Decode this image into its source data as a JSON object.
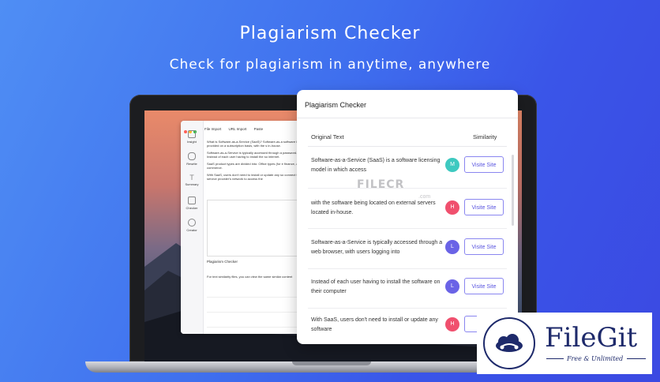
{
  "hero": {
    "title": "Plagiarism Checker",
    "subtitle": "Check for plagiarism in anytime, anywhere"
  },
  "app": {
    "sidebar": [
      {
        "label": "Insight",
        "icon": "insight-icon"
      },
      {
        "label": "Rewrite",
        "icon": "rewrite-icon"
      },
      {
        "label": "Summary",
        "icon": "summary-icon"
      },
      {
        "label": "Checker",
        "icon": "checker-icon"
      },
      {
        "label": "Creator",
        "icon": "creator-icon"
      }
    ],
    "toolbar": {
      "file_import": "File Import",
      "url_import": "URL Import",
      "paste": "Paste"
    },
    "text": [
      "What is Software-as-a-Service (SaaS)? Software-as-a software is provided on a subscription basis, with the s in-house.",
      "Software-as-a-Service is typically accessed through a password. Instead of each user having to install the so internet.",
      "SaaS product types are divided into: Office types (for e finance, and e-commerce.",
      "With SaaS, users don't need to install or update any so connect to the service provider's network to access the"
    ],
    "panel_label": "Plagiarism Checker",
    "note": "For text similarity files, you can view the same similar content"
  },
  "panel": {
    "title": "Plagiarism Checker",
    "col_original": "Original Text",
    "col_similarity": "Similarity",
    "rows": [
      {
        "text": "Software-as-a-Service (SaaS) is a software licensing model in which access",
        "avatar": "M",
        "color": "#3ec9c0",
        "button": "Visite Site"
      },
      {
        "text": "with the software being located on external servers located in-house.",
        "avatar": "H",
        "color": "#f0506e",
        "button": "Visite Site"
      },
      {
        "text": "Software-as-a-Service is typically accessed through a web browser, with users logging into",
        "avatar": "L",
        "color": "#6a63e6",
        "button": "Visite Site"
      },
      {
        "text": "Instead of each user having to install the software on their computer",
        "avatar": "L",
        "color": "#6a63e6",
        "button": "Visite Site"
      },
      {
        "text": "With SaaS, users don't need to install or update any software",
        "avatar": "H",
        "color": "#f0506e",
        "button": "Visi"
      }
    ]
  },
  "watermark": {
    "text": "FILECR",
    "sub": ".com"
  },
  "logo": {
    "name": "FileGit",
    "tagline": "Free & Unlimited",
    "color": "#1e2a6b"
  }
}
